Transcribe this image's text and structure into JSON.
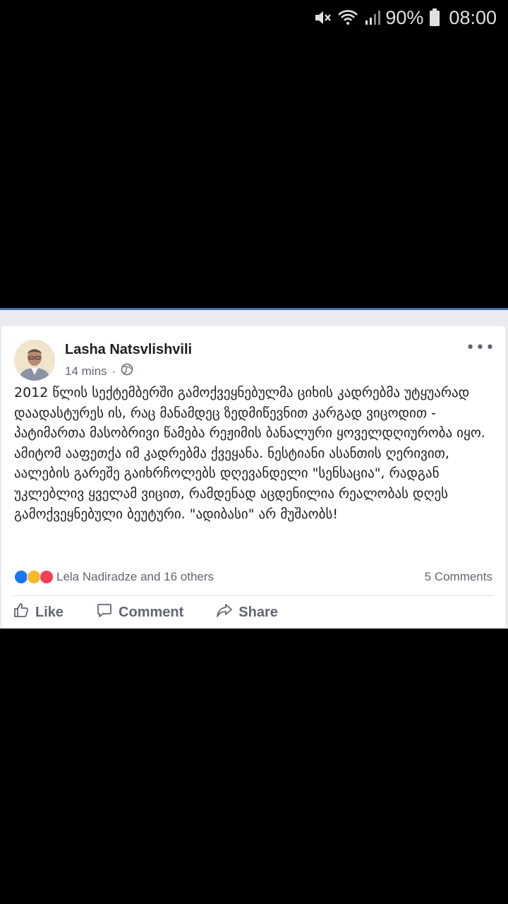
{
  "status_bar": {
    "battery_percent": "90%",
    "time": "08:00",
    "icons": [
      "mute-icon",
      "wifi-icon",
      "signal-icon",
      "battery-icon"
    ]
  },
  "post": {
    "author": "Lasha Natsvlishvili",
    "time_ago": "14 mins",
    "privacy_icon": "globe-icon",
    "more_label": "•••",
    "text": "2012 წლის სექტემბერში გამოქვეყნებულმა ციხის კადრებმა უტყუარად დაადასტურეს ის, რაც მანამდეც ზედმიწევნით კარგად ვიცოდით - პატიმართა მასობრივი წამება რეჟიმის ბანალური ყოველდღიურობა იყო. ამიტომ ააფეთქა იმ კადრებმა ქვეყანა. ნესტიანი ასანთის ღერივით, აალების გარეშე გაიხრჩოლებს დღევანდელი \"სენსაცია\", რადგან უკლებლივ ყველამ ვიცით, რამდენად აცდენილია რეალობას დღეს გამოქვეყნებული ბეუტური. \"ადიბასი\" არ მუშაობს!",
    "reactions": {
      "icons": [
        "like-reaction-icon",
        "haha-reaction-icon",
        "love-reaction-icon"
      ],
      "label": "Lela Nadiradze and 16 others"
    },
    "comments_label": "5 Comments",
    "actions": {
      "like": "Like",
      "comment": "Comment",
      "share": "Share"
    }
  }
}
